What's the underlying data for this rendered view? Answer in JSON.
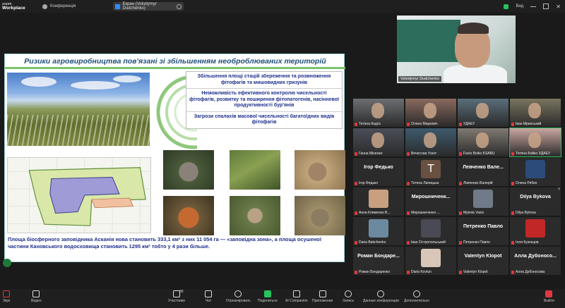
{
  "app": {
    "logo_line1": "zoom",
    "logo_line2": "Workplace",
    "conference_label": "Конференція"
  },
  "screen_share": {
    "label": "Екран (Volodymyr Dudchenko)"
  },
  "view_label": "Вид",
  "slide": {
    "title": "Ризики агровиробництва пов'язані зі збільшенням необроблюваних територій",
    "risks": [
      "Збільшення площі стацій збереження та розмноження фітофагів та мишовидних гризунів",
      "Неможливість ефективного контролю чисельності фітофагів, розвитку та поширення фітопатогенів, насінневої продуктивності бур'янів",
      "Загрози спалахів масової чисельності багатоїдних видів фітофагів"
    ],
    "caption": "Площа біосферного заповідника Асканія нова становить 333,1 км² з них 11 054 га — «заповідна зона», а площа осушеної частини Каховського водосховища становить 1295 км² тобто у 4 рази більше."
  },
  "speaker": {
    "name": "Volodymyr Dudchenko"
  },
  "participants": [
    {
      "name": "Тетяна Кодос",
      "type": "video",
      "color": "#6c6f72"
    },
    {
      "name": "Олена Маркевіч",
      "type": "video",
      "color": "#8a6a5e"
    },
    {
      "name": "УДАЕУ",
      "type": "video",
      "color": "#5a6e7a"
    },
    {
      "name": "Іван Мринський",
      "type": "video",
      "color": "#7a7560"
    },
    {
      "name": "Ганна Міненко",
      "type": "video",
      "color": "#4a4e58"
    },
    {
      "name": "Вячеслав Ускот",
      "type": "video",
      "color": "#3e5b6e"
    },
    {
      "name": "Favio Boiko KSABU",
      "type": "video",
      "color": "#7f7a72"
    },
    {
      "name": "Тетяна Бойко ХДАЕУ",
      "type": "video",
      "color": "#c9a6a0"
    },
    {
      "name": "Ігор Федько",
      "type": "name",
      "color": ""
    },
    {
      "name": "Тетяна Лапицька",
      "type": "avatar",
      "color": "#6a5040",
      "initial": "T"
    },
    {
      "name": "Левченко Валерій",
      "type": "name",
      "color": ""
    },
    {
      "name": "Олена Рябих",
      "type": "avatar",
      "color": "#2c4a7a"
    },
    {
      "name": "Анна Клименко В...",
      "type": "avatar",
      "color": "#c8a080"
    },
    {
      "name": "Мирошниченко ...",
      "type": "name",
      "color": ""
    },
    {
      "name": "Mykola Vasiv",
      "type": "avatar",
      "color": "#707a88"
    },
    {
      "name": "Dilya Bykova",
      "type": "name",
      "color": ""
    },
    {
      "name": "Daria Babchenko",
      "type": "avatar",
      "color": "#6b8aa0"
    },
    {
      "name": "Іван Остропольський",
      "type": "avatar",
      "color": "#4a4a55"
    },
    {
      "name": "Петренко Павло",
      "type": "name",
      "color": ""
    },
    {
      "name": "Ілля Кузнєцов",
      "type": "avatar",
      "color": "#c02828"
    },
    {
      "name": "Роман Бондаренко",
      "type": "name",
      "color": ""
    },
    {
      "name": "Daria Kovtun",
      "type": "avatar",
      "color": "#d8c6b8"
    },
    {
      "name": "Valentyn Klopot",
      "type": "name",
      "color": ""
    },
    {
      "name": "Алла Дубоносова",
      "type": "name",
      "color": ""
    }
  ],
  "big_names": {
    "8": "Ігор Федько",
    "10": "Левченко Вале...",
    "13": "Мирошниченк...",
    "18": "Петренко Павло",
    "20": "Роман Бондаре...",
    "22": "Valentyn Klopot",
    "23": "Алла Дубоносо..."
  },
  "toolbar": [
    {
      "label": "Звук",
      "icon": "microphone-muted-icon"
    },
    {
      "label": "Видео",
      "icon": "video-camera-icon"
    },
    {
      "label": "Участники",
      "icon": "participants-icon",
      "count": "88"
    },
    {
      "label": "Чат",
      "icon": "chat-icon"
    },
    {
      "label": "Отреагировать",
      "icon": "reaction-heart-icon"
    },
    {
      "label": "Поделиться",
      "icon": "share-screen-icon"
    },
    {
      "label": "AI Companion",
      "icon": "ai-companion-icon"
    },
    {
      "label": "Приложения",
      "icon": "apps-icon"
    },
    {
      "label": "Запись",
      "icon": "record-icon"
    },
    {
      "label": "Данные конференции",
      "icon": "info-icon"
    },
    {
      "label": "Дополнительно",
      "icon": "more-icon"
    },
    {
      "label": "Выйти",
      "icon": "leave-icon"
    }
  ]
}
